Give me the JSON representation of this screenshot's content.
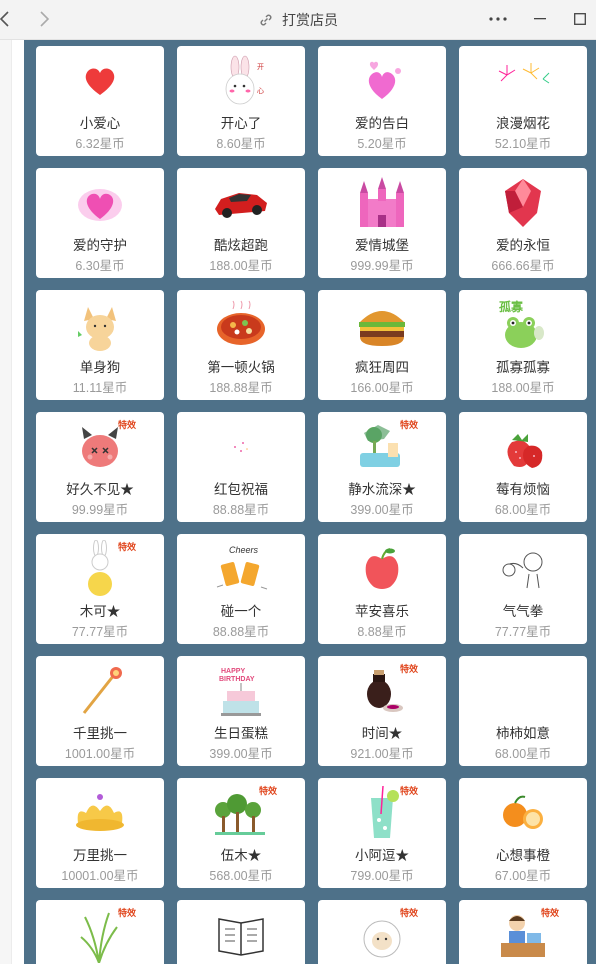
{
  "window": {
    "title": "打赏店员",
    "icons": {
      "back": "chevron-left-icon",
      "forward": "chevron-right-icon",
      "link": "link-icon",
      "more": "more-icon",
      "minimize": "minimize-icon",
      "maximize": "maximize-icon"
    }
  },
  "colors": {
    "panel_bg": "#4e7189",
    "card_bg": "#ffffff",
    "price": "#9a9a9a",
    "name": "#333333"
  },
  "gifts": [
    {
      "name": "小爱心",
      "price": "6.32星币",
      "icon": "heart-icon"
    },
    {
      "name": "开心了",
      "price": "8.60星币",
      "icon": "bunny-icon"
    },
    {
      "name": "爱的告白",
      "price": "5.20星币",
      "icon": "heart-balloon-icon"
    },
    {
      "name": "浪漫烟花",
      "price": "52.10星币",
      "icon": "fireworks-icon"
    },
    {
      "name": "爱的守护",
      "price": "6.30星币",
      "icon": "winged-heart-icon"
    },
    {
      "name": "酷炫超跑",
      "price": "188.00星币",
      "icon": "sports-car-icon"
    },
    {
      "name": "爱情城堡",
      "price": "999.99星币",
      "icon": "castle-icon"
    },
    {
      "name": "爱的永恒",
      "price": "666.66星币",
      "icon": "diamond-icon"
    },
    {
      "name": "单身狗",
      "price": "11.11星币",
      "icon": "dog-icon"
    },
    {
      "name": "第一顿火锅",
      "price": "188.88星币",
      "icon": "hotpot-icon"
    },
    {
      "name": "疯狂周四",
      "price": "166.00星币",
      "icon": "burger-icon"
    },
    {
      "name": "孤寡孤寡",
      "price": "188.00星币",
      "icon": "frog-icon"
    },
    {
      "name": "好久不见★",
      "price": "99.99星币",
      "icon": "devil-face-icon",
      "badge": "特效"
    },
    {
      "name": "红包祝福",
      "price": "88.88星币",
      "icon": "sparkle-icon"
    },
    {
      "name": "静水流深★",
      "price": "399.00星币",
      "icon": "landscape-icon",
      "badge": "特效"
    },
    {
      "name": "莓有烦恼",
      "price": "68.00星币",
      "icon": "strawberry-icon"
    },
    {
      "name": "木可★",
      "price": "77.77星币",
      "icon": "bunny-balloon-icon",
      "badge": "特效"
    },
    {
      "name": "碰一个",
      "price": "88.88星币",
      "icon": "cheers-icon"
    },
    {
      "name": "苹安喜乐",
      "price": "8.88星币",
      "icon": "apple-icon"
    },
    {
      "name": "气气拳",
      "price": "77.77星币",
      "icon": "punch-icon"
    },
    {
      "name": "千里挑一",
      "price": "1001.00星币",
      "icon": "scepter-icon"
    },
    {
      "name": "生日蛋糕",
      "price": "399.00星币",
      "icon": "cake-icon"
    },
    {
      "name": "时间★",
      "price": "921.00星币",
      "icon": "wine-jar-icon",
      "badge": "特效"
    },
    {
      "name": "柿柿如意",
      "price": "68.00星币",
      "icon": "blank-icon"
    },
    {
      "name": "万里挑一",
      "price": "10001.00星币",
      "icon": "crown-icon"
    },
    {
      "name": "伍木★",
      "price": "568.00星币",
      "icon": "trees-icon",
      "badge": "特效"
    },
    {
      "name": "小阿逗★",
      "price": "799.00星币",
      "icon": "drink-icon",
      "badge": "特效"
    },
    {
      "name": "心想事橙",
      "price": "67.00星币",
      "icon": "orange-icon"
    },
    {
      "name": "",
      "price": "",
      "icon": "grass-icon",
      "badge": "特效"
    },
    {
      "name": "",
      "price": "",
      "icon": "book-icon"
    },
    {
      "name": "",
      "price": "",
      "icon": "sheep-icon",
      "badge": "特效"
    },
    {
      "name": "",
      "price": "",
      "icon": "desk-worker-icon",
      "badge": "特效"
    }
  ]
}
